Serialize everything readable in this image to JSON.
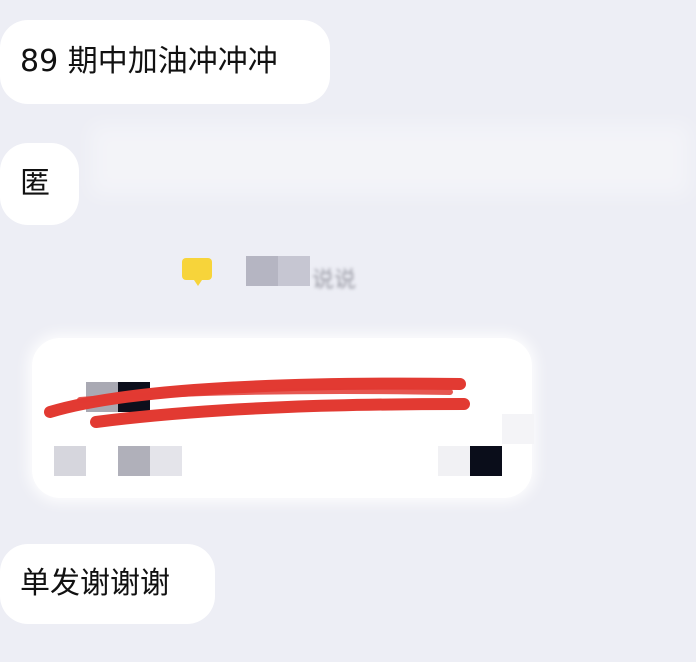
{
  "messages": [
    {
      "text": "89 期中加油冲冲冲"
    },
    {
      "text": "匿"
    },
    {
      "text": "单发谢谢谢"
    }
  ],
  "notice": {
    "icon": "yellow-chat-icon",
    "text": "说说"
  },
  "colors": {
    "background": "#edeef5",
    "bubble": "#ffffff",
    "scribble": "#e23a32",
    "notice_icon": "#f7d43a"
  }
}
